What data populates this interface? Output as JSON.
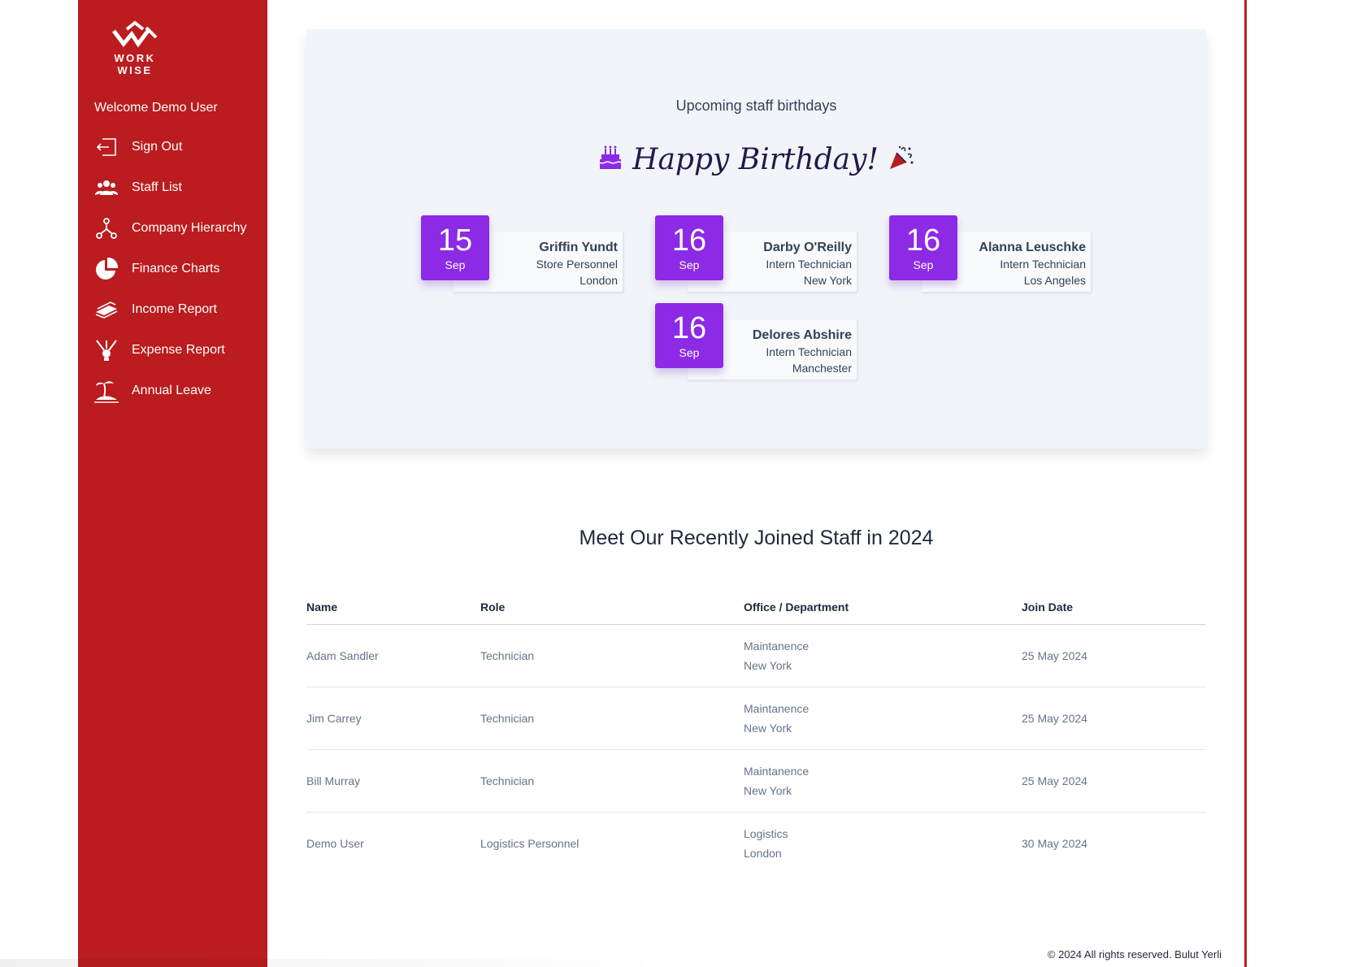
{
  "brand": {
    "logo_text": "WORK WISE"
  },
  "sidebar": {
    "welcome": "Welcome Demo User",
    "items": [
      {
        "label": "Sign Out",
        "icon": "sign-out-icon"
      },
      {
        "label": "Staff List",
        "icon": "users-icon"
      },
      {
        "label": "Company Hierarchy",
        "icon": "hierarchy-icon"
      },
      {
        "label": "Finance Charts",
        "icon": "pie-chart-icon"
      },
      {
        "label": "Income Report",
        "icon": "money-icon"
      },
      {
        "label": "Expense Report",
        "icon": "expense-icon"
      },
      {
        "label": "Annual Leave",
        "icon": "island-icon"
      }
    ]
  },
  "birthdays": {
    "title": "Upcoming staff birthdays",
    "greeting": "Happy Birthday!",
    "cards": [
      {
        "day": "15",
        "month": "Sep",
        "name": "Griffin Yundt",
        "role": "Store Personnel",
        "city": "London"
      },
      {
        "day": "16",
        "month": "Sep",
        "name": "Darby O'Reilly",
        "role": "Intern Technician",
        "city": "New York"
      },
      {
        "day": "16",
        "month": "Sep",
        "name": "Alanna Leuschke",
        "role": "Intern Technician",
        "city": "Los Angeles"
      },
      {
        "day": "16",
        "month": "Sep",
        "name": "Delores Abshire",
        "role": "Intern Technician",
        "city": "Manchester"
      }
    ]
  },
  "recent": {
    "title": "Meet Our Recently Joined Staff in 2024",
    "columns": [
      "Name",
      "Role",
      "Office / Department",
      "Join Date"
    ],
    "rows": [
      {
        "name": "Adam Sandler",
        "role": "Technician",
        "department": "Maintanence",
        "office": "New York",
        "join_date": "25 May 2024"
      },
      {
        "name": "Jim Carrey",
        "role": "Technician",
        "department": "Maintanence",
        "office": "New York",
        "join_date": "25 May 2024"
      },
      {
        "name": "Bill Murray",
        "role": "Technician",
        "department": "Maintanence",
        "office": "New York",
        "join_date": "25 May 2024"
      },
      {
        "name": "Demo User",
        "role": "Logistics Personnel",
        "department": "Logistics",
        "office": "London",
        "join_date": "30 May 2024"
      }
    ]
  },
  "footer": {
    "text": "© 2024 All rights reserved. Bulut Yerli"
  },
  "colors": {
    "sidebar": "#ba1c1f",
    "date_badge": "#8c2ae6",
    "name_link": "#9a2a12",
    "card_bg": "#f1f5f9"
  }
}
